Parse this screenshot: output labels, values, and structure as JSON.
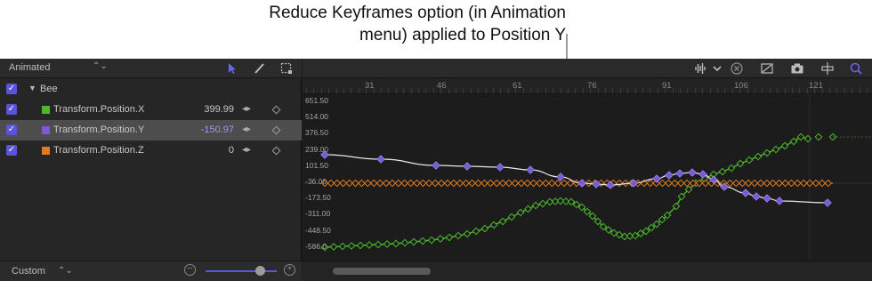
{
  "callout": {
    "line1": "Reduce Keyframes option (in Animation",
    "line2": "menu) applied to Position Y"
  },
  "left_panel": {
    "filter_label": "Animated",
    "tools": [
      "arrow-tool-icon",
      "pen-tool-icon",
      "box-select-icon"
    ],
    "group": {
      "label": "Bee",
      "checked": true
    },
    "parameters": [
      {
        "label": "Transform.Position.X",
        "value": "399.99",
        "color": "#4cb82c",
        "selected": false
      },
      {
        "label": "Transform.Position.Y",
        "value": "-150.97",
        "color": "#7a58d6",
        "selected": true
      },
      {
        "label": "Transform.Position.Z",
        "value": "0",
        "color": "#e07b1f",
        "selected": false
      }
    ],
    "footer_label": "Custom",
    "zoom_level": 0.7
  },
  "toolbar": {
    "icons": [
      "audio-waveform-icon",
      "chevron-down-icon",
      "clear-icon",
      "fit-curve-icon",
      "snapshot-camera-icon",
      "snap-icon",
      "zoom-to-fit-icon"
    ]
  },
  "ruler": {
    "labels": [
      "31",
      "46",
      "61",
      "76",
      "91",
      "106",
      "121"
    ]
  },
  "axis": {
    "labels": [
      "651.50",
      "514.00",
      "376.50",
      "239.00",
      "101.50",
      "-36.00",
      "-173.50",
      "-311.00",
      "-448.50",
      "-586.0"
    ]
  },
  "colors": {
    "accent": "#5b57e0",
    "x_curve": "#4cb82c",
    "y_curve": "#7a58d6",
    "z_curve": "#e07b1f"
  }
}
